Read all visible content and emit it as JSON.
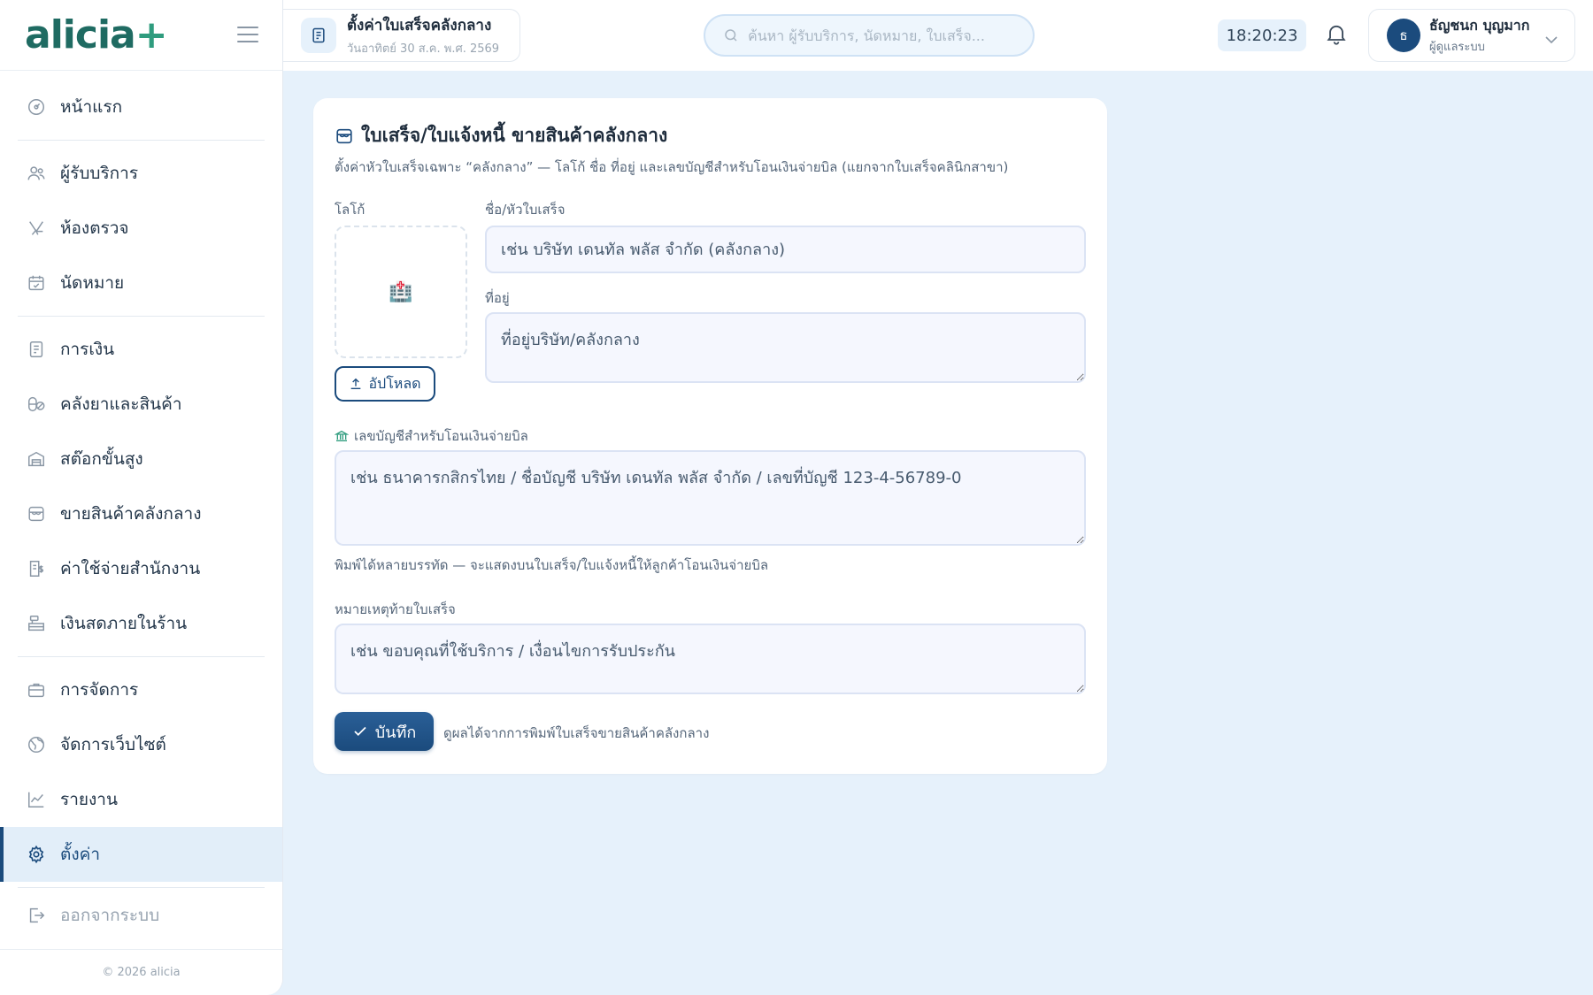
{
  "brand": {
    "name": "alicia",
    "plus": "+"
  },
  "sidebar": {
    "items": [
      {
        "label": "หน้าแรก",
        "icon": "dashboard-icon"
      },
      {
        "label": "ผู้รับบริการ",
        "icon": "users-icon"
      },
      {
        "label": "ห้องตรวจ",
        "icon": "dental-chair-icon"
      },
      {
        "label": "นัดหมาย",
        "icon": "calendar-check-icon"
      },
      {
        "label": "การเงิน",
        "icon": "receipt-icon"
      },
      {
        "label": "คลังยาและสินค้า",
        "icon": "pills-icon"
      },
      {
        "label": "สต๊อกขั้นสูง",
        "icon": "warehouse-icon"
      },
      {
        "label": "ขายสินค้าคลังกลาง",
        "icon": "store-icon"
      },
      {
        "label": "ค่าใช้จ่ายสำนักงาน",
        "icon": "expense-icon"
      },
      {
        "label": "เงินสดภายในร้าน",
        "icon": "cash-register-icon"
      },
      {
        "label": "การจัดการ",
        "icon": "briefcase-icon"
      },
      {
        "label": "จัดการเว็บไซต์",
        "icon": "globe-icon"
      },
      {
        "label": "รายงาน",
        "icon": "chart-line-icon"
      },
      {
        "label": "ตั้งค่า",
        "icon": "gear-icon",
        "active": true
      },
      {
        "label": "ออกจากระบบ",
        "icon": "logout-icon"
      }
    ],
    "footer": "© 2026 alicia"
  },
  "topbar": {
    "page_title": "ตั้งค่าใบเสร็จคลังกลาง",
    "page_date": "วันอาทิตย์ 30 ส.ค. พ.ศ. 2569",
    "search_placeholder": "ค้นหา ผู้รับบริการ, นัดหมาย, ใบเสร็จ...",
    "clock": "18:20:23",
    "user_initial": "ธ",
    "user_name": "ธัญชนก บุญมาก",
    "user_role": "ผู้ดูแลระบบ"
  },
  "card": {
    "title": "ใบเสร็จ/ใบแจ้งหนี้ ขายสินค้าคลังกลาง",
    "subtitle": "ตั้งค่าหัวใบเสร็จเฉพาะ “คลังกลาง” — โลโก้ ชื่อ ที่อยู่ และเลขบัญชีสำหรับโอนเงินจ่ายบิล (แยกจากใบเสร็จคลินิกสาขา)",
    "logo_label": "โลโก้",
    "logo_placeholder": "🏥",
    "upload_label": "อัปโหลด",
    "name_label": "ชื่อ/หัวใบเสร็จ",
    "name_placeholder": "เช่น บริษัท เดนทัล พลัส จำกัด (คลังกลาง)",
    "address_label": "ที่อยู่",
    "address_placeholder": "ที่อยู่บริษัท/คลังกลาง",
    "bank_label": "เลขบัญชีสำหรับโอนเงินจ่ายบิล",
    "bank_placeholder": "เช่น ธนาคารกสิกรไทย / ชื่อบัญชี บริษัท เดนทัล พลัส จำกัด / เลขที่บัญชี 123-4-56789-0",
    "bank_hint": "พิมพ์ได้หลายบรรทัด — จะแสดงบนใบเสร็จ/ใบแจ้งหนี้ให้ลูกค้าโอนเงินจ่ายบิล",
    "note_label": "หมายเหตุท้ายใบเสร็จ",
    "note_placeholder": "เช่น ขอบคุณที่ใช้บริการ / เงื่อนไขการรับประกัน",
    "save_label": "บันทึก",
    "save_note": "ดูผลได้จากการพิมพ์ใบเสร็จขายสินค้าคลังกลาง"
  },
  "colors": {
    "primary": "#1b4b7d",
    "brand": "#1f6b62",
    "background": "#e6f1fb"
  }
}
